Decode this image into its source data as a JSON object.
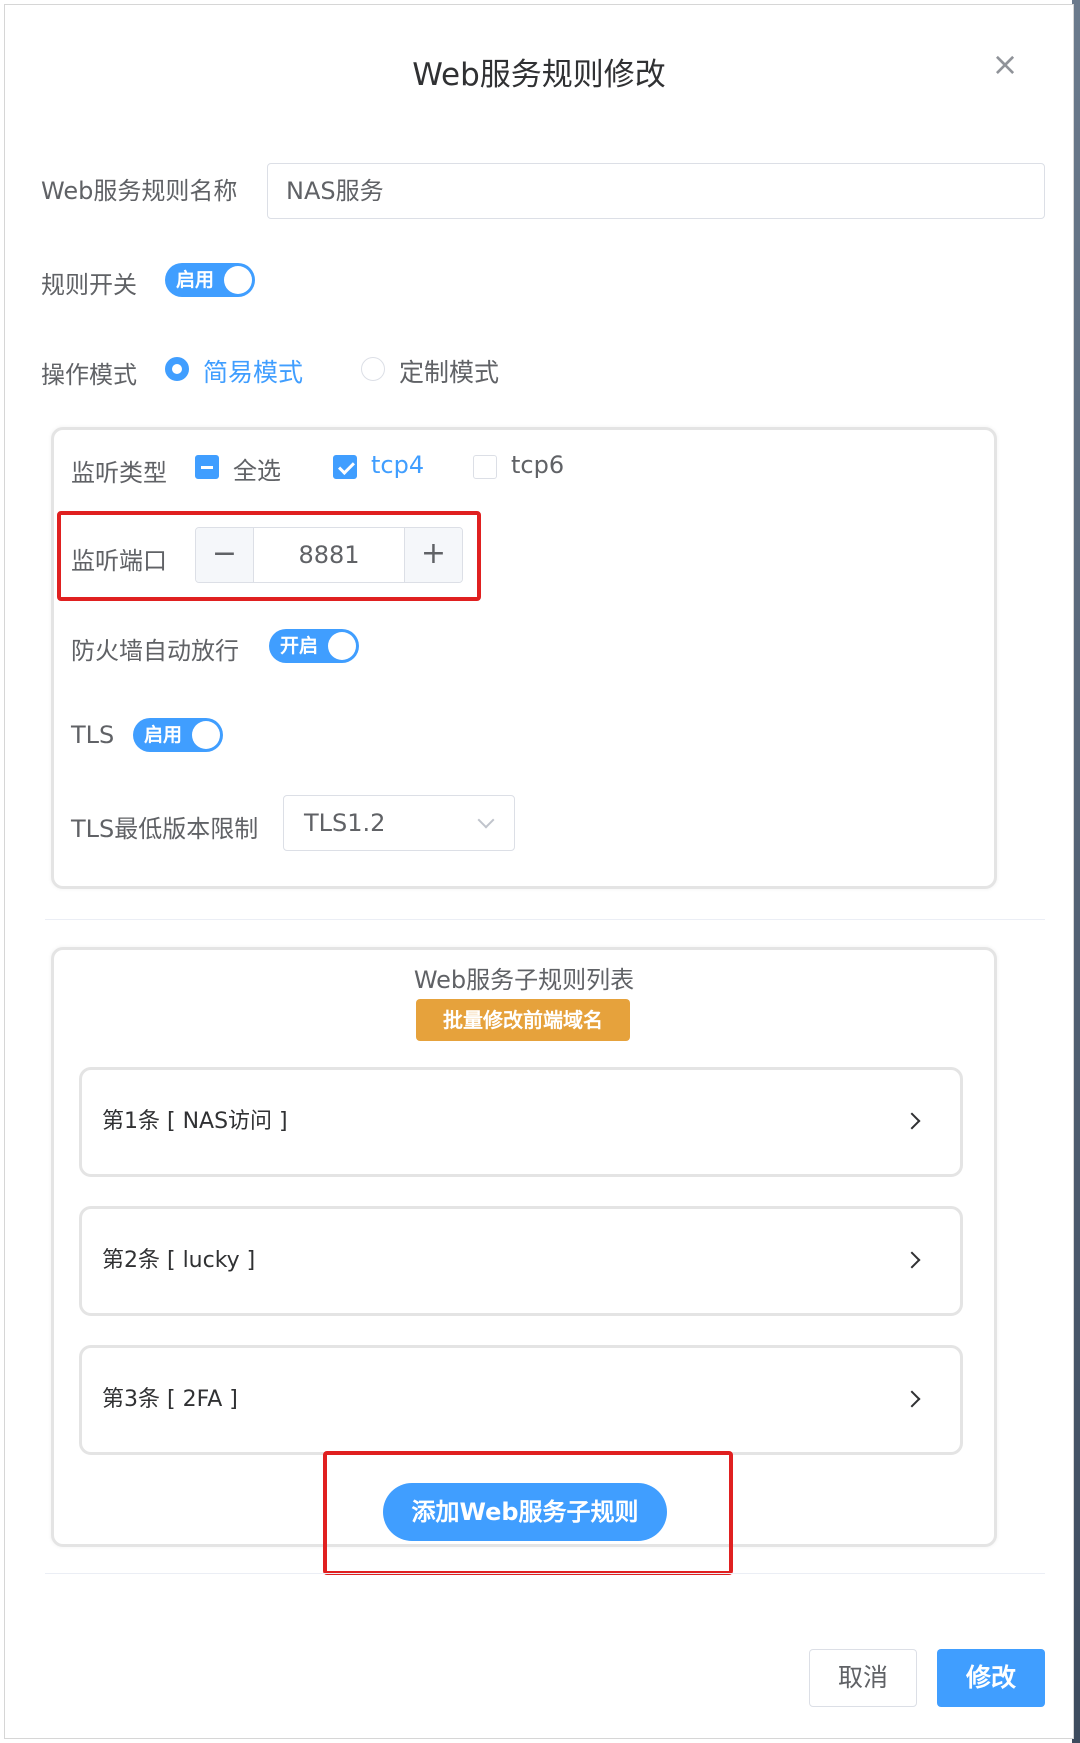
{
  "dialog": {
    "title": "Web服务规则修改",
    "close_icon": "close-icon"
  },
  "form": {
    "rule_name_label": "Web服务规则名称",
    "rule_name_value": "NAS服务",
    "rule_switch_label": "规则开关",
    "rule_switch_text": "启用",
    "mode_label": "操作模式",
    "mode_options": [
      "简易模式",
      "定制模式"
    ],
    "mode_selected": "简易模式"
  },
  "listen": {
    "type_label": "监听类型",
    "types": [
      "全选",
      "tcp4",
      "tcp6"
    ],
    "port_label": "监听端口",
    "port_value": "8881",
    "minus_symbol": "−",
    "plus_symbol": "+",
    "firewall_label": "防火墙自动放行",
    "firewall_switch_text": "开启",
    "tls_label": "TLS",
    "tls_switch_text": "启用",
    "tls_min_label": "TLS最低版本限制",
    "tls_min_value": "TLS1.2"
  },
  "subrules": {
    "title": "Web服务子规则列表",
    "batch_button": "批量修改前端域名",
    "items": [
      "第1条 [ NAS访问 ]",
      "第2条 [ lucky ]",
      "第3条 [ 2FA ]"
    ],
    "add_button": "添加Web服务子规则"
  },
  "footer": {
    "cancel": "取消",
    "confirm": "修改"
  },
  "colors": {
    "primary": "#409eff",
    "warning": "#e6a23c",
    "highlight_box": "#e02020"
  }
}
